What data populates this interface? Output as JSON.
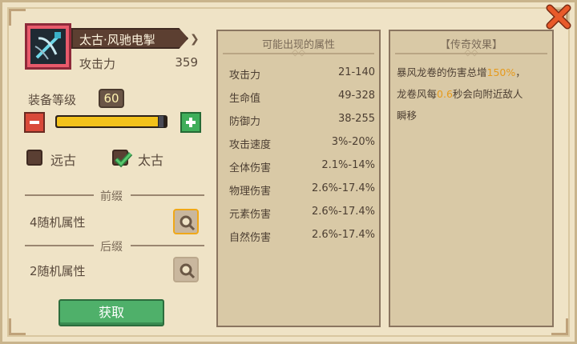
{
  "item": {
    "name": "太古·风驰电掣",
    "stat_label": "攻击力",
    "stat_value": "359"
  },
  "level": {
    "label": "装备等级",
    "value": "60",
    "fill_fraction": 0.97
  },
  "options": {
    "yuangu_label": "远古",
    "taigu_label": "太古",
    "yuangu_checked": false,
    "taigu_checked": true
  },
  "prefix": {
    "title": "前缀",
    "text": "4随机属性"
  },
  "suffix": {
    "title": "后缀",
    "text": "2随机属性"
  },
  "get_button": "获取",
  "attributes": {
    "title": "可能出现的属性",
    "rows": [
      {
        "name": "攻击力",
        "value": "21-140"
      },
      {
        "name": "生命值",
        "value": "49-328"
      },
      {
        "name": "防御力",
        "value": "38-255"
      },
      {
        "name": "攻击速度",
        "value": "3%-20%"
      },
      {
        "name": "全体伤害",
        "value": "2.1%-14%"
      },
      {
        "name": "物理伤害",
        "value": "2.6%-17.4%"
      },
      {
        "name": "元素伤害",
        "value": "2.6%-17.4%"
      },
      {
        "name": "自然伤害",
        "value": "2.6%-17.4%"
      }
    ]
  },
  "legendary": {
    "title": "【传奇效果】",
    "line1_a": "暴风龙卷的伤害总增",
    "line1_hl": "150%",
    "line1_b": "，",
    "line2_a": "龙卷风每",
    "line2_hl": "0.6",
    "line2_b": "秒会向附近敌人",
    "line3": "瞬移"
  },
  "colors": {
    "accent": "#e69a1c",
    "close": "#e85a2a",
    "button_green": "#4fb06a"
  }
}
